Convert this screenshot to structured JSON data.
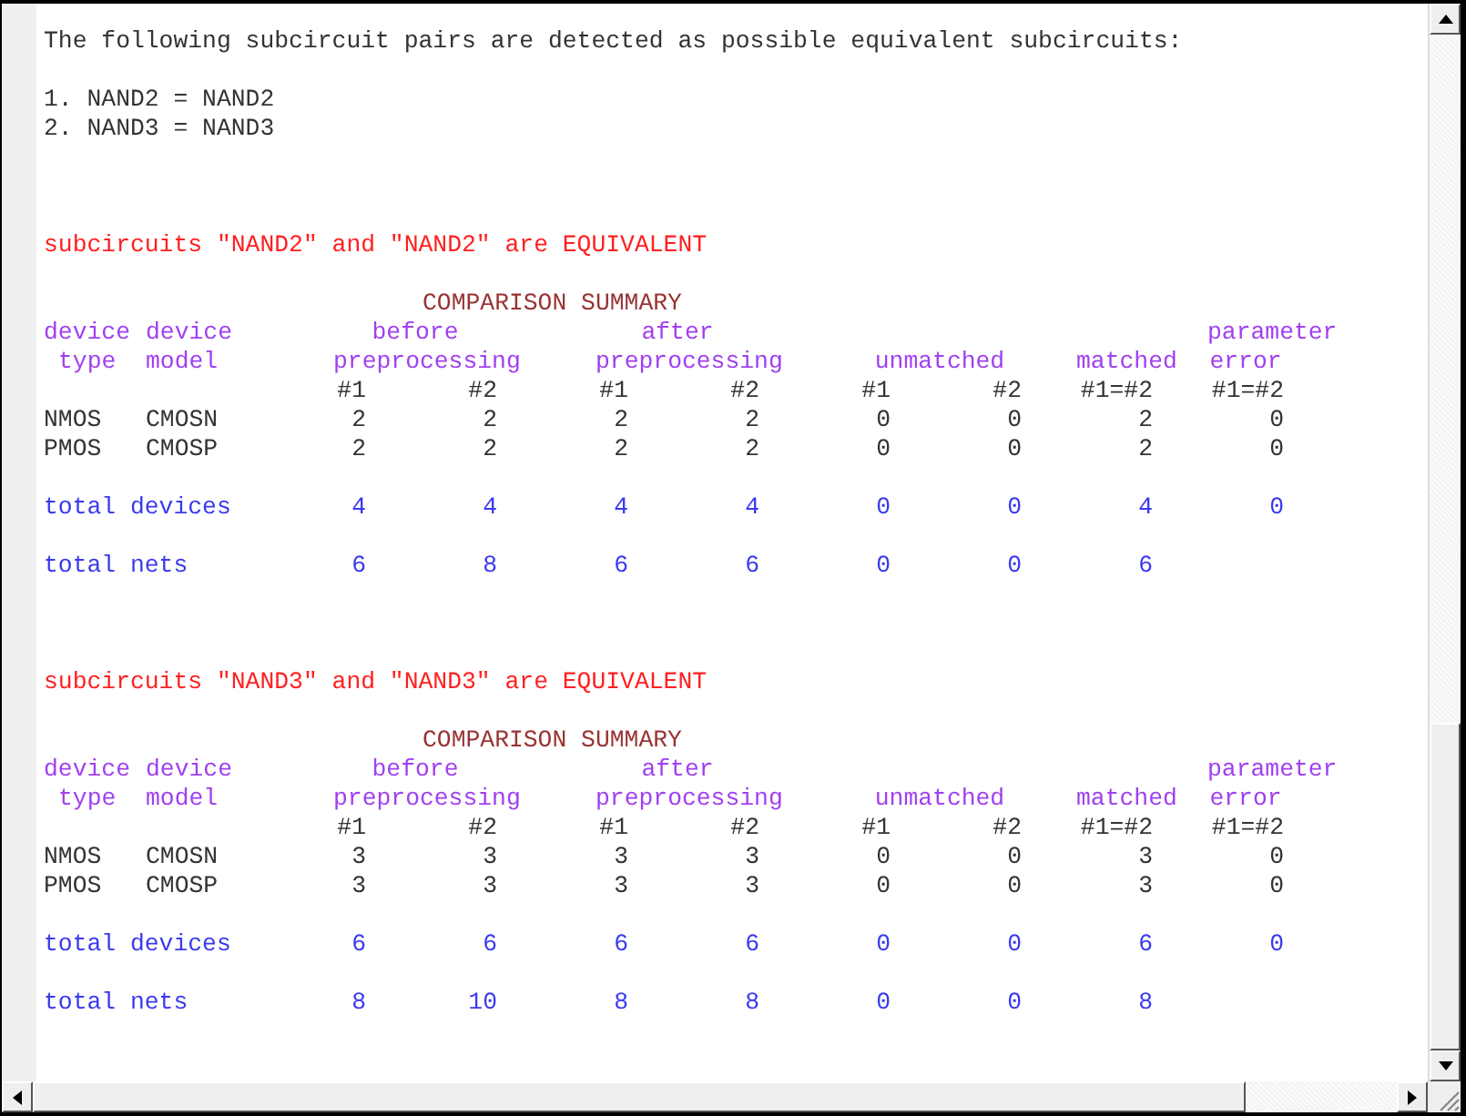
{
  "intro": "The following subcircuit pairs are detected as possible equivalent subcircuits:",
  "pairs": [
    "1. NAND2 = NAND2",
    "2. NAND3 = NAND3"
  ],
  "comparisons": [
    {
      "verdict": "subcircuits \"NAND2\" and \"NAND2\" are EQUIVALENT",
      "title": "COMPARISON SUMMARY",
      "header": {
        "device_labels": [
          {
            "top": "device",
            "bottom": "type"
          },
          {
            "top": "device",
            "bottom": "model"
          }
        ],
        "groups": [
          {
            "top": "before",
            "bottom": "preprocessing"
          },
          {
            "top": "after",
            "bottom": "preprocessing"
          },
          {
            "bottom": "unmatched"
          },
          {
            "bottom": "matched"
          },
          {
            "top": "parameter",
            "bottom": "error"
          }
        ],
        "sub": [
          "#1",
          "#2",
          "#1",
          "#2",
          "#1",
          "#2",
          "#1=#2",
          "#1=#2"
        ]
      },
      "rows": [
        {
          "kind": "device",
          "type": "NMOS",
          "model": "CMOSN",
          "values": [
            "2",
            "2",
            "2",
            "2",
            "0",
            "0",
            "2",
            "0"
          ]
        },
        {
          "kind": "device",
          "type": "PMOS",
          "model": "CMOSP",
          "values": [
            "2",
            "2",
            "2",
            "2",
            "0",
            "0",
            "2",
            "0"
          ]
        },
        {
          "kind": "total",
          "label": "total devices",
          "values": [
            "4",
            "4",
            "4",
            "4",
            "0",
            "0",
            "4",
            "0"
          ]
        },
        {
          "kind": "total",
          "label": "total nets",
          "values": [
            "6",
            "8",
            "6",
            "6",
            "0",
            "0",
            "6"
          ]
        }
      ]
    },
    {
      "verdict": "subcircuits \"NAND3\" and \"NAND3\" are EQUIVALENT",
      "title": "COMPARISON SUMMARY",
      "header": {
        "device_labels": [
          {
            "top": "device",
            "bottom": "type"
          },
          {
            "top": "device",
            "bottom": "model"
          }
        ],
        "groups": [
          {
            "top": "before",
            "bottom": "preprocessing"
          },
          {
            "top": "after",
            "bottom": "preprocessing"
          },
          {
            "bottom": "unmatched"
          },
          {
            "bottom": "matched"
          },
          {
            "top": "parameter",
            "bottom": "error"
          }
        ],
        "sub": [
          "#1",
          "#2",
          "#1",
          "#2",
          "#1",
          "#2",
          "#1=#2",
          "#1=#2"
        ]
      },
      "rows": [
        {
          "kind": "device",
          "type": "NMOS",
          "model": "CMOSN",
          "values": [
            "3",
            "3",
            "3",
            "3",
            "0",
            "0",
            "3",
            "0"
          ]
        },
        {
          "kind": "device",
          "type": "PMOS",
          "model": "CMOSP",
          "values": [
            "3",
            "3",
            "3",
            "3",
            "0",
            "0",
            "3",
            "0"
          ]
        },
        {
          "kind": "total",
          "label": "total devices",
          "values": [
            "6",
            "6",
            "6",
            "6",
            "0",
            "0",
            "6",
            "0"
          ]
        },
        {
          "kind": "total",
          "label": "total nets",
          "values": [
            "8",
            "10",
            "8",
            "8",
            "0",
            "0",
            "8"
          ]
        }
      ]
    }
  ]
}
